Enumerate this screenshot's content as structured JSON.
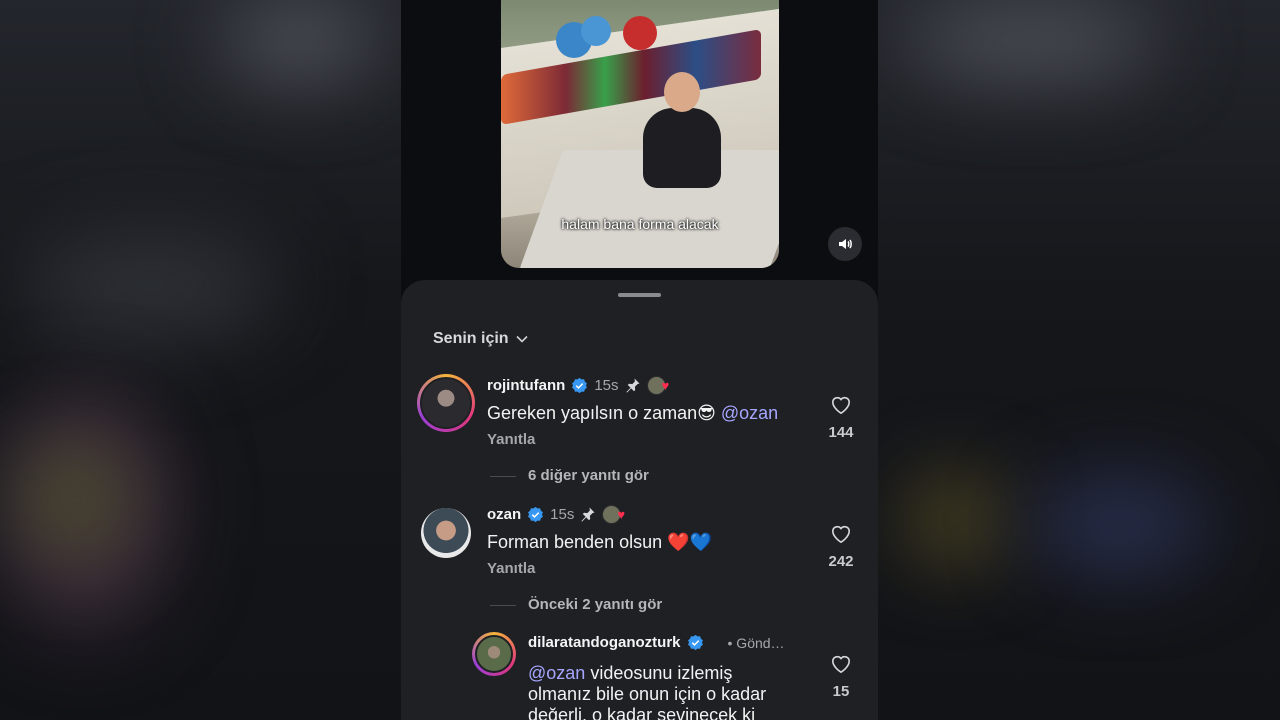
{
  "video": {
    "caption": "halam bana forma alacak"
  },
  "comments_sheet": {
    "sort_label": "Senin için"
  },
  "comments": [
    {
      "username": "rojintufann",
      "time": "15s",
      "text_before": "Gereken yapılsın o zaman😎 ",
      "mention": "@ozan",
      "text_after": "",
      "reply_label": "Yanıtla",
      "likes": "144",
      "more_replies": "6 diğer yanıtı gör"
    },
    {
      "username": "ozan",
      "time": "15s",
      "text_before": "Forman benden olsun ❤️💙",
      "mention": "",
      "text_after": "",
      "reply_label": "Yanıtla",
      "likes": "242",
      "more_replies": "Önceki 2 yanıtı gör"
    }
  ],
  "nested_reply": {
    "username": "dilaratandoganozturk",
    "time": "• Gönd…",
    "mention": "@ozan",
    "line1_rest": " videosunu izlemiş",
    "line2": "olmanız bile onun için o kadar",
    "line3": "değerli, o kadar sevinecek ki",
    "likes": "15"
  },
  "colors": {
    "mention": "#a6a6ff",
    "verified": "#3897f0",
    "like_heart_red": "#ff2e4f"
  }
}
